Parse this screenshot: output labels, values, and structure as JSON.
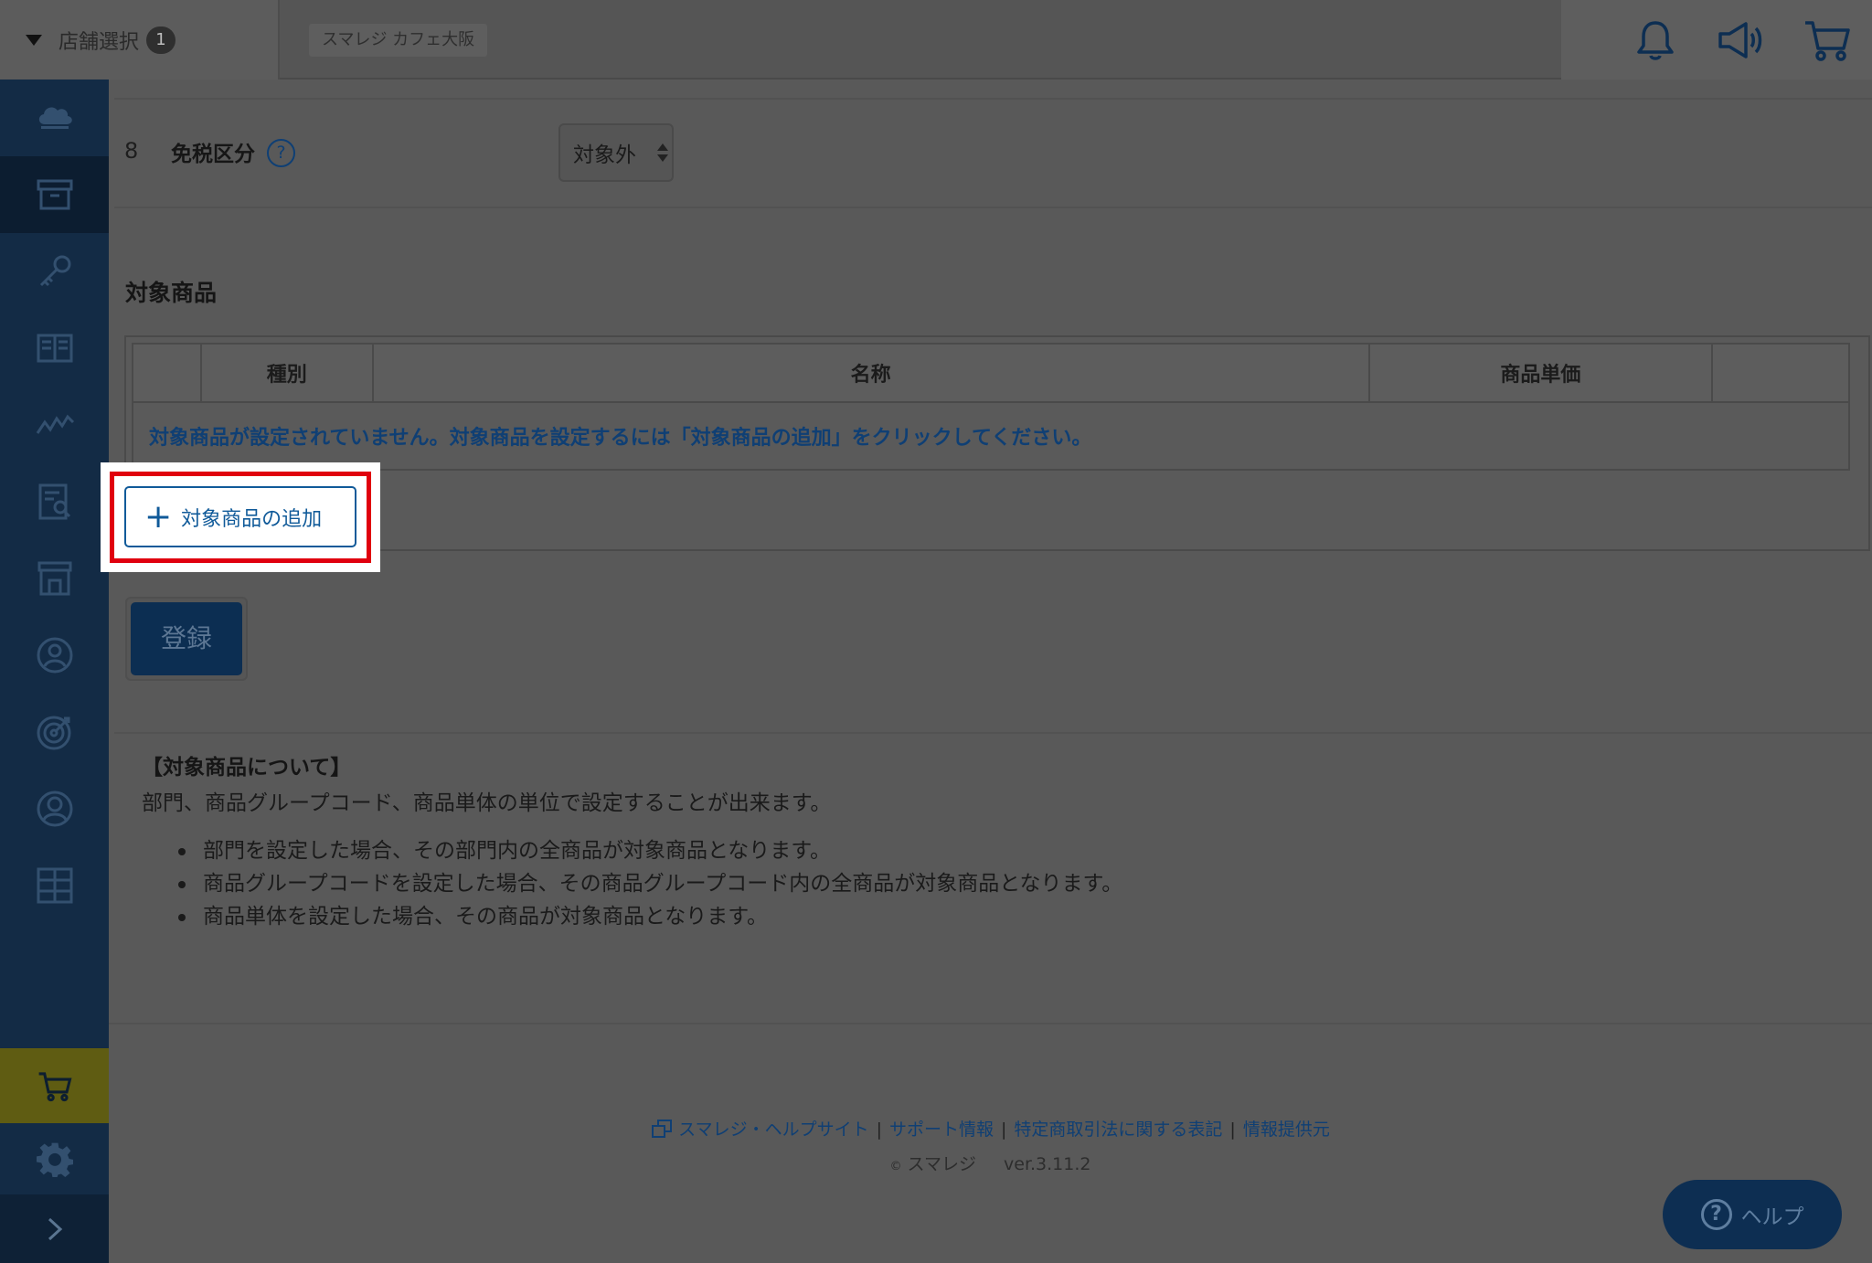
{
  "header": {
    "store_select_label": "店舗選択",
    "store_count": "1",
    "shop_name": "スマレジ カフェ大阪"
  },
  "form": {
    "row_number": "8",
    "tax_free_label": "免税区分",
    "help_mark": "?",
    "tax_free_value": "対象外"
  },
  "target_products": {
    "section_title": "対象商品",
    "columns": [
      "",
      "種別",
      "名称",
      "商品単価",
      ""
    ],
    "empty_message": "対象商品が設定されていません。対象商品を設定するには「対象商品の追加」をクリックしてください。",
    "add_button_label": "対象商品の追加",
    "add_button_icon": "+"
  },
  "register_button_label": "登録",
  "info": {
    "title": "【対象商品について】",
    "description": "部門、商品グループコード、商品単体の単位で設定することが出来ます。",
    "bullets": [
      "部門を設定した場合、その部門内の全商品が対象商品となります。",
      "商品グループコードを設定した場合、その商品グループコード内の全商品が対象商品となります。",
      "商品単体を設定した場合、その商品が対象商品となります。"
    ]
  },
  "footer": {
    "links": [
      "スマレジ・ヘルプサイト",
      "サポート情報",
      "特定商取引法に関する表記",
      "情報提供元"
    ],
    "separator": "|",
    "copyright_mark": "©",
    "copyright": "スマレジ",
    "version": "ver.3.11.2"
  },
  "help_button": {
    "icon_text": "?",
    "label": "ヘルプ"
  },
  "colors": {
    "sidebar": "#132b45",
    "link": "#0f3f74",
    "highlight_border": "#e0000e",
    "primary_button": "#0c2e52"
  }
}
